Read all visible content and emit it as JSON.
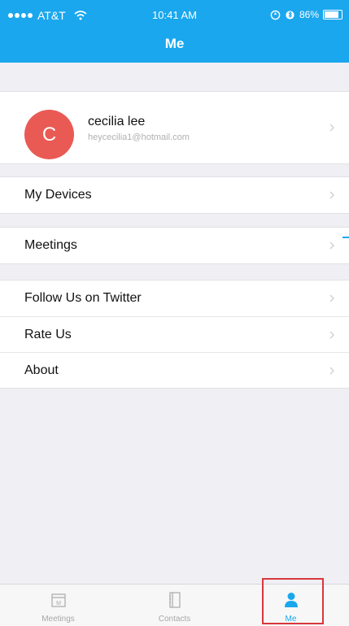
{
  "status_bar": {
    "carrier": "AT&T",
    "time": "10:41 AM",
    "battery": "86%"
  },
  "header": {
    "title": "Me"
  },
  "profile": {
    "initial": "C",
    "name": "cecilia lee",
    "email": "heycecilia1@hotmail.com"
  },
  "menu": {
    "devices": "My Devices",
    "meetings": "Meetings",
    "twitter": "Follow Us on Twitter",
    "rate": "Rate Us",
    "about": "About"
  },
  "tabs": [
    {
      "label": "Meetings",
      "icon": "calendar-icon"
    },
    {
      "label": "Contacts",
      "icon": "contacts-book-icon"
    },
    {
      "label": "Me",
      "icon": "person-icon"
    }
  ],
  "colors": {
    "accent": "#1aa7ee",
    "avatar": "#ea5a54",
    "background": "#efeff4",
    "highlight_box": "#d9373c"
  }
}
